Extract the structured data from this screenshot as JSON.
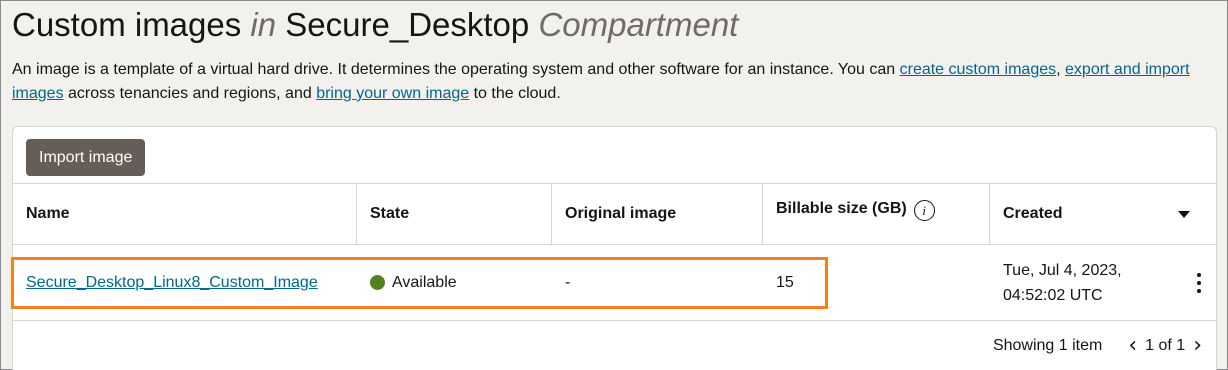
{
  "header": {
    "title_main": "Custom images",
    "title_in": "in",
    "title_compartment": "Secure_Desktop",
    "title_suffix": "Compartment"
  },
  "description": {
    "text_1": "An image is a template of a virtual hard drive. It determines the operating system and other software for an instance. You can ",
    "link_create": "create custom images",
    "text_2": ", ",
    "link_export": "export and import images",
    "text_3": " across tenancies and regions, and ",
    "link_byoi": "bring your own image",
    "text_4": " to the cloud."
  },
  "toolbar": {
    "import_label": "Import image"
  },
  "table": {
    "columns": {
      "name": "Name",
      "state": "State",
      "original": "Original image",
      "billable": "Billable size (GB)",
      "created": "Created"
    },
    "info_glyph": "i",
    "rows": [
      {
        "name": "Secure_Desktop_Linux8_Custom_Image",
        "state": "Available",
        "state_color": "#508223",
        "original": "-",
        "billable": "15",
        "created_line1": "Tue, Jul 4, 2023,",
        "created_line2": "04:52:02 UTC"
      }
    ]
  },
  "pagination": {
    "showing": "Showing 1 item",
    "pages": "1 of 1",
    "prev_icon": "‹",
    "next_icon": "›"
  },
  "colors": {
    "accent_highlight": "#f08423",
    "link": "#00688c",
    "button": "#645d58"
  }
}
